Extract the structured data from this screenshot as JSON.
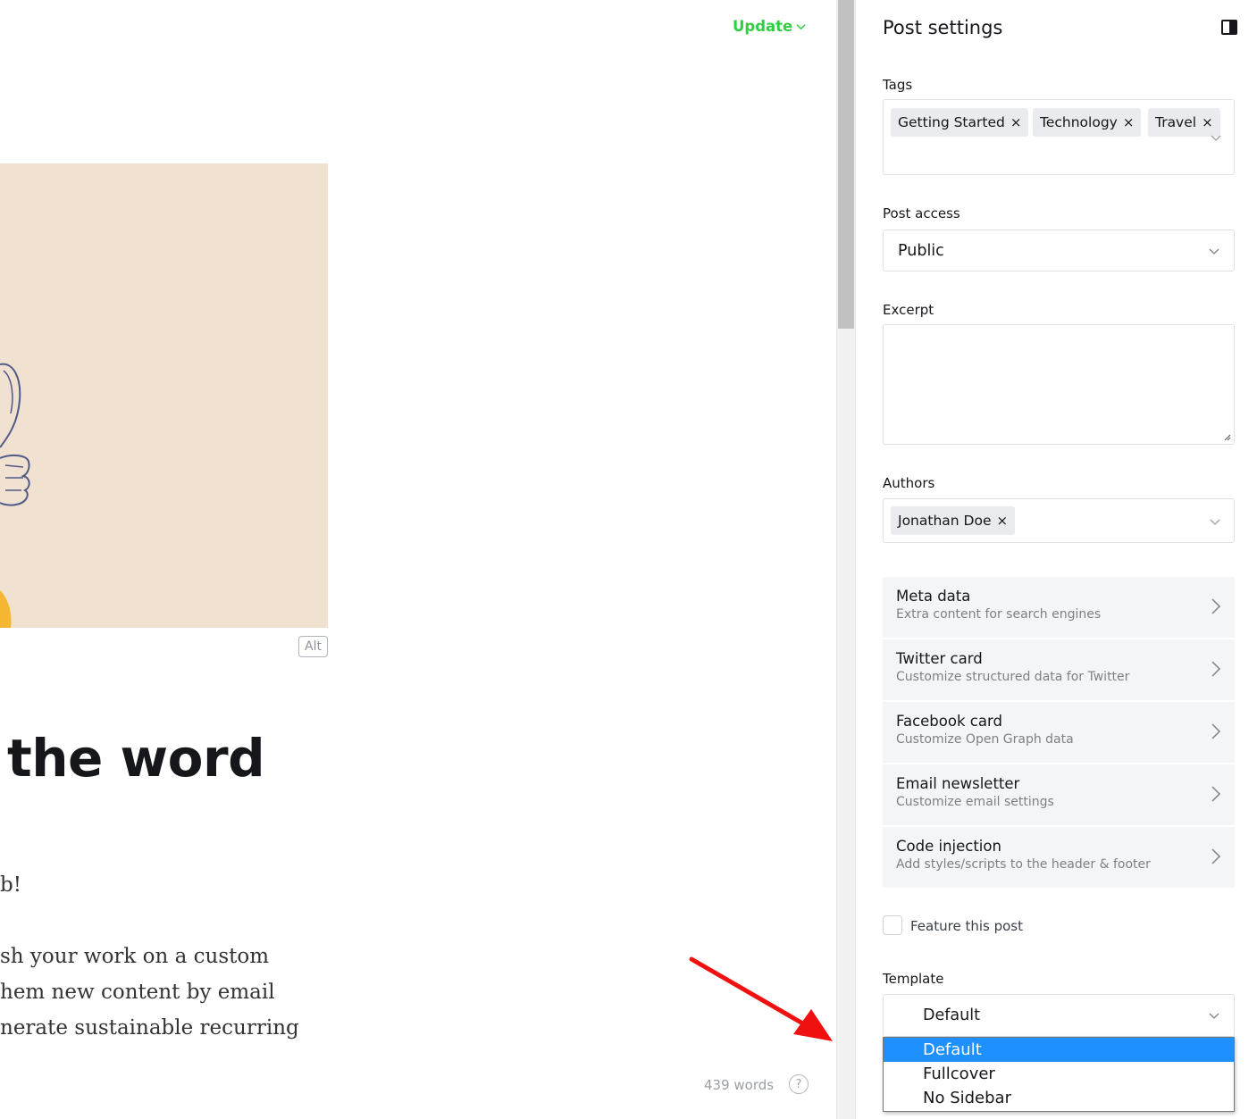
{
  "editor": {
    "update_label": "Update",
    "alt_label": "Alt",
    "title_fragment": "the word",
    "body_lines": [
      "b!",
      "sh your work on a custom",
      "hem new content by email",
      "nerate sustainable recurring"
    ],
    "word_count": "439 words",
    "help_glyph": "?",
    "accent_color": "#30cf43"
  },
  "sidebar": {
    "title": "Post settings",
    "tags": {
      "label": "Tags",
      "items": [
        "Getting Started",
        "Technology",
        "Travel"
      ]
    },
    "post_access": {
      "label": "Post access",
      "value": "Public"
    },
    "excerpt": {
      "label": "Excerpt",
      "value": ""
    },
    "authors": {
      "label": "Authors",
      "items": [
        "Jonathan Doe"
      ]
    },
    "menu": [
      {
        "title": "Meta data",
        "subtitle": "Extra content for search engines"
      },
      {
        "title": "Twitter card",
        "subtitle": "Customize structured data for Twitter"
      },
      {
        "title": "Facebook card",
        "subtitle": "Customize Open Graph data"
      },
      {
        "title": "Email newsletter",
        "subtitle": "Customize email settings"
      },
      {
        "title": "Code injection",
        "subtitle": "Add styles/scripts to the header & footer"
      }
    ],
    "feature": {
      "label": "Feature this post",
      "checked": false
    },
    "template": {
      "label": "Template",
      "value": "Default",
      "options": [
        "Default",
        "Fullcover",
        "No Sidebar"
      ],
      "highlighted": "Default",
      "highlight_color": "#1e90ff"
    },
    "close_glyph": "×"
  }
}
